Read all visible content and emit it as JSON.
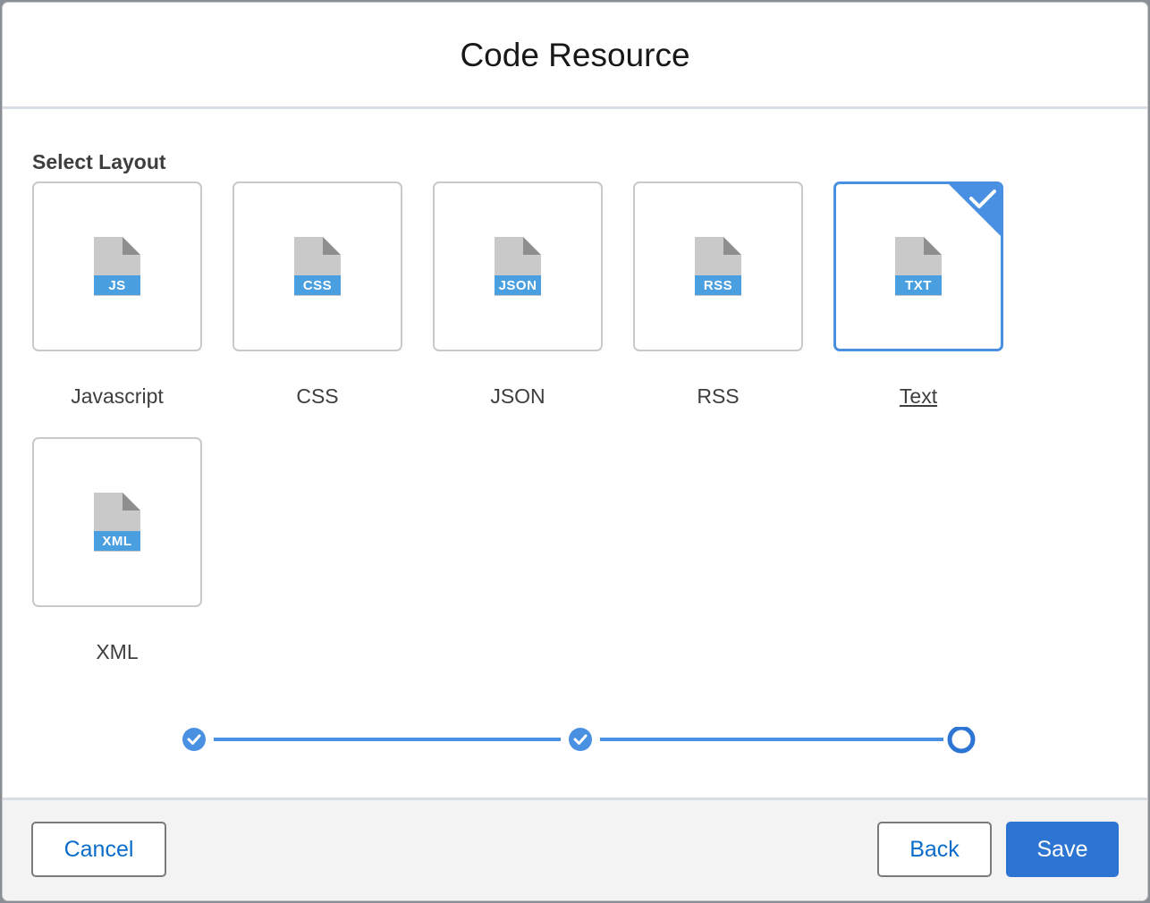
{
  "modal": {
    "title": "Code Resource"
  },
  "layout_section": {
    "label": "Select Layout",
    "selected": "Text",
    "options": [
      {
        "label": "Javascript",
        "badge": "JS",
        "selected": false
      },
      {
        "label": "CSS",
        "badge": "CSS",
        "selected": false
      },
      {
        "label": "JSON",
        "badge": "JSON",
        "selected": false
      },
      {
        "label": "RSS",
        "badge": "RSS",
        "selected": false
      },
      {
        "label": "Text",
        "badge": "TXT",
        "selected": true
      },
      {
        "label": "XML",
        "badge": "XML",
        "selected": false
      }
    ]
  },
  "progress": {
    "steps": [
      {
        "state": "complete",
        "icon": "check-icon"
      },
      {
        "state": "complete",
        "icon": "check-icon"
      },
      {
        "state": "current",
        "icon": "ring-icon"
      }
    ]
  },
  "footer": {
    "cancel_label": "Cancel",
    "back_label": "Back",
    "save_label": "Save"
  },
  "colors": {
    "accent": "#4a90e2",
    "brand_button": "#2d75d2",
    "link_text": "#0b6cc9",
    "file_badge": "#4a9fe0",
    "file_body": "#c9c9c9"
  }
}
